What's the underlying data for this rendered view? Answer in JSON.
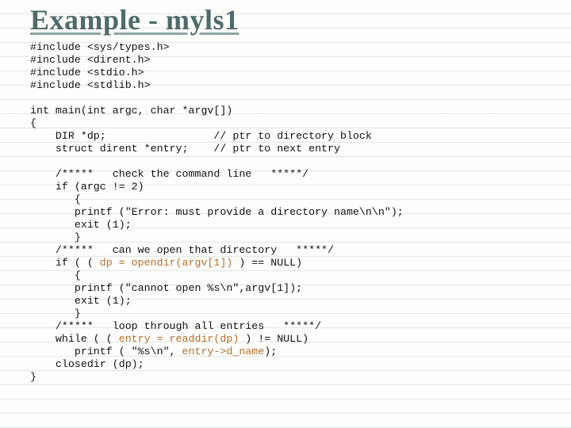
{
  "title": "Example - myls1",
  "code": {
    "includes": [
      "#include <sys/types.h>",
      "#include <dirent.h>",
      "#include <stdio.h>",
      "#include <stdlib.h>"
    ],
    "sig": "int main(int argc, char *argv[])",
    "brace_open": "{",
    "dp_decl": "    DIR *dp;                 // ptr to directory block",
    "entry_decl": "    struct dirent *entry;    // ptr to next entry",
    "c1": "    /*****   check the command line   *****/",
    "l1": "    if (argc != 2)",
    "l2": "       {",
    "l3": "       printf (\"Error: must provide a directory name\\n\\n\");",
    "l4": "       exit (1);",
    "l5": "       }",
    "c2": "    /*****   can we open that directory   *****/",
    "l6a": "    if ( ( ",
    "l6hl": "dp = opendir(argv[1])",
    "l6b": " ) == NULL)",
    "l7": "       {",
    "l8": "       printf (\"cannot open %s\\n\",argv[1]);",
    "l9": "       exit (1);",
    "l10": "       }",
    "c3": "    /*****   loop through all entries   *****/",
    "l11a": "    while ( ( ",
    "l11hl": "entry = readdir(dp)",
    "l11b": " ) != NULL)",
    "l12a": "       printf ( \"%s\\n\", ",
    "l12hl": "entry->d_name",
    "l12b": ");",
    "l13": "    closedir (dp);",
    "brace_close": "}"
  }
}
